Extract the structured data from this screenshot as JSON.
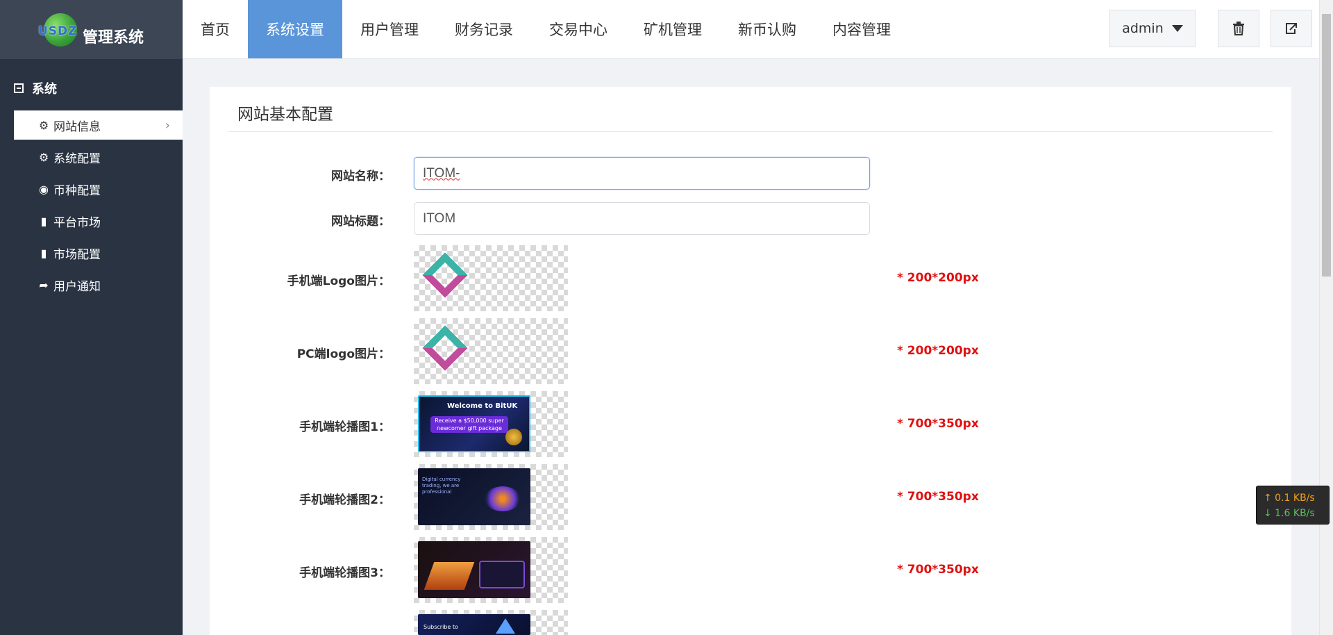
{
  "brand": {
    "logo_text": "USDZ",
    "title": "管理系统"
  },
  "nav": {
    "tabs": [
      "首页",
      "系统设置",
      "用户管理",
      "财务记录",
      "交易中心",
      "矿机管理",
      "新币认购",
      "内容管理"
    ],
    "active_index": 1
  },
  "header": {
    "user": "admin",
    "trash_icon": "trash-icon",
    "export_icon": "export-icon"
  },
  "sidebar": {
    "section": "系统",
    "items": [
      {
        "label": "网站信息",
        "icon": "gear-icon",
        "active": true
      },
      {
        "label": "系统配置",
        "icon": "gear-icon",
        "active": false
      },
      {
        "label": "币种配置",
        "icon": "target-icon",
        "active": false
      },
      {
        "label": "平台市场",
        "icon": "bar-chart-icon",
        "active": false
      },
      {
        "label": "市场配置",
        "icon": "bar-chart-icon",
        "active": false
      },
      {
        "label": "用户通知",
        "icon": "share-icon",
        "active": false
      }
    ]
  },
  "panel": {
    "title": "网站基本配置",
    "site_name_label": "网站名称：",
    "site_name_value": "ITOM-",
    "site_title_label": "网站标题：",
    "site_title_value": "ITOM",
    "mobile_logo_label": "手机端Logo图片：",
    "pc_logo_label": "PC端logo图片：",
    "carousel1_label": "手机端轮播图1：",
    "carousel2_label": "手机端轮播图2：",
    "carousel3_label": "手机端轮播图3：",
    "logo_size": "* 200*200px",
    "banner_size": "* 700*350px",
    "required_color": "#e01010"
  },
  "banners": {
    "b1_title": "Welcome to BitUK",
    "b1_bar": "Receive a $50,000 super newcomer gift package",
    "b2_text": "Digital currency trading, we are professional",
    "b4_text": "Subscribe to"
  },
  "netspeed": {
    "up": "↑ 0.1 KB/s",
    "down": "↓ 1.6 KB/s"
  }
}
